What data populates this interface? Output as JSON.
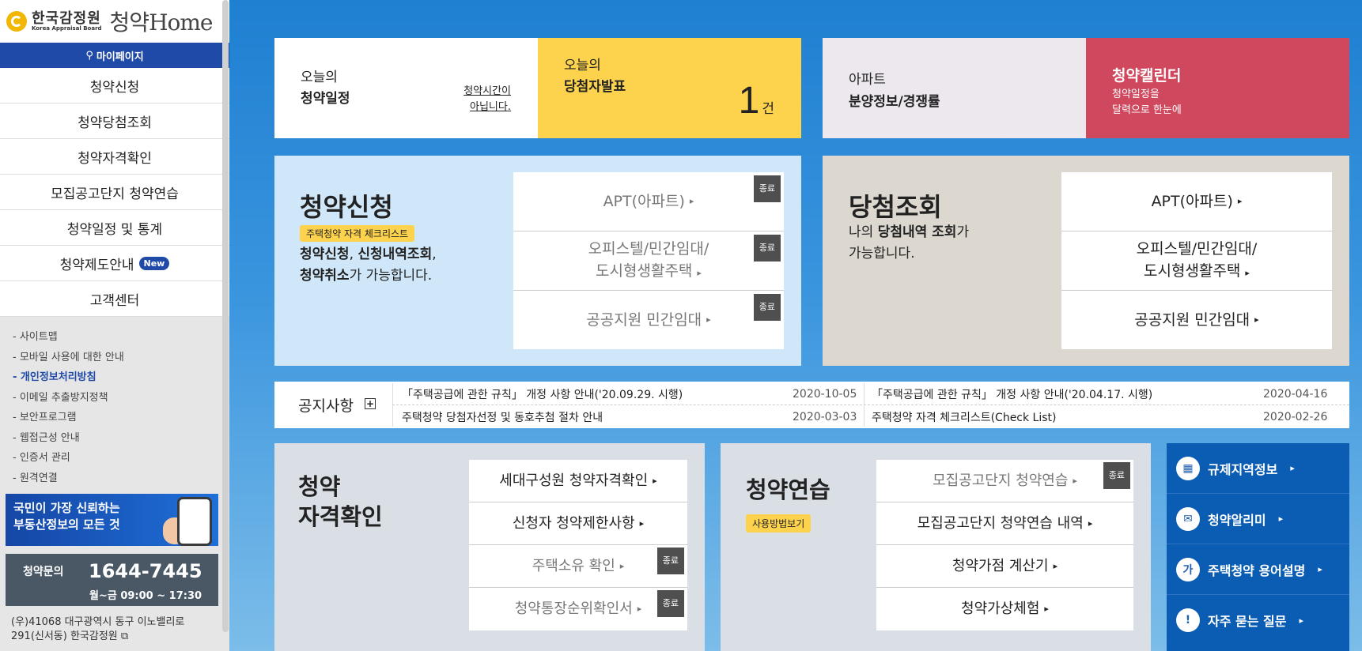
{
  "sidebar": {
    "logo": {
      "org_ko": "한국감정원",
      "org_en": "Korea Appraisal Board",
      "brand_ko": "청약",
      "brand_en": "Home"
    },
    "mypage": "마이페이지",
    "menu": [
      "청약신청",
      "청약당첨조회",
      "청약자격확인",
      "모집공고단지 청약연습",
      "청약일정 및 통계",
      "청약제도안내",
      "고객센터"
    ],
    "new_badge": "New",
    "links": [
      "- 사이트맵",
      "- 모바일 사용에 대한 안내",
      "- 개인정보처리방침",
      "- 이메일 추출방지정책",
      "- 보안프로그램",
      "- 웹접근성 안내",
      "- 인증서 관리",
      "- 원격연결"
    ],
    "banner1": {
      "line1": "국민이 가장 신뢰하는",
      "line2": "부동산정보의 모든 것"
    },
    "banner2": {
      "label": "청약문의",
      "phone": "1644-7445",
      "hours": "월~금 09:00 ~ 17:30"
    },
    "address_line1": "(우)41068 대구광역시 동구 이노밸리로",
    "address_line2": "291(신서동) 한국감정원"
  },
  "top": {
    "schedule": {
      "line1": "오늘의",
      "line2": "청약일정",
      "note1": "청약시간이",
      "note2": "아닙니다."
    },
    "winners": {
      "line1": "오늘의",
      "line2": "당첨자발표",
      "count": "1",
      "unit": "건"
    },
    "apt": {
      "line1": "아파트",
      "line2": "분양정보/경쟁률"
    },
    "calendar": {
      "title": "청약캘린더",
      "sub1": "청약일정을",
      "sub2": "달력으로 한눈에"
    }
  },
  "apply": {
    "title": "청약신청",
    "badge": "주택청약 자격 체크리스트",
    "desc_b1": "청약신청",
    "desc_sep1": ", ",
    "desc_b2": "신청내역조회",
    "desc_sep2": ",",
    "desc_b3": "청약취소",
    "desc_tail": "가 가능합니다.",
    "items": [
      {
        "l1": "APT(아파트)",
        "l2": ""
      },
      {
        "l1": "오피스텔/민간임대/",
        "l2": "도시형생활주택"
      },
      {
        "l1": "공공지원 민간임대",
        "l2": ""
      }
    ],
    "end": "종료"
  },
  "win": {
    "title": "당첨조회",
    "desc_pre": "나의 ",
    "desc_b": "당첨내역 조회",
    "desc_tail": "가",
    "desc_l2": "가능합니다.",
    "items": [
      {
        "l1": "APT(아파트)",
        "l2": ""
      },
      {
        "l1": "오피스텔/민간임대/",
        "l2": "도시형생활주택"
      },
      {
        "l1": "공공지원 민간임대",
        "l2": ""
      }
    ]
  },
  "notice": {
    "title": "공지사항",
    "plus": "+",
    "items": [
      {
        "text": "「주택공급에 관한 규칙」 개정 사항 안내('20.09.29. 시행)",
        "date": "2020-10-05"
      },
      {
        "text": "「주택공급에 관한 규칙」 개정 사항 안내('20.04.17. 시행)",
        "date": "2020-04-16"
      },
      {
        "text": "주택청약 당첨자선정 및 동호추첨 절차 안내",
        "date": "2020-03-03"
      },
      {
        "text": "주택청약 자격 체크리스트(Check List)",
        "date": "2020-02-26"
      }
    ]
  },
  "qual": {
    "title1": "청약",
    "title2": "자격확인",
    "items": [
      "세대구성원 청약자격확인",
      "신청자 청약제한사항",
      "주택소유 확인",
      "청약통장순위확인서"
    ]
  },
  "practice": {
    "title": "청약연습",
    "badge": "사용방법보기",
    "items": [
      "모집공고단지 청약연습",
      "모집공고단지 청약연습 내역",
      "청약가점 계산기",
      "청약가상체험"
    ]
  },
  "rightlinks": [
    {
      "icon": "building-icon",
      "glyph": "▦",
      "label": "규제지역정보"
    },
    {
      "icon": "mail-icon",
      "glyph": "✉",
      "label": "청약알리미"
    },
    {
      "icon": "ga-icon",
      "glyph": "가",
      "label": "주택청약 용어설명"
    },
    {
      "icon": "exclamation-icon",
      "glyph": "!",
      "label": "자주 묻는 질문"
    }
  ],
  "arrow": "▸",
  "colors": {
    "navy": "#1f4aa8",
    "yellow": "#fdd34d",
    "red": "#d0485e",
    "lightblue": "#cfe7f8",
    "beige": "#dcd8d0",
    "grayblue": "#d9dfe4",
    "blue": "#0b5db3"
  }
}
